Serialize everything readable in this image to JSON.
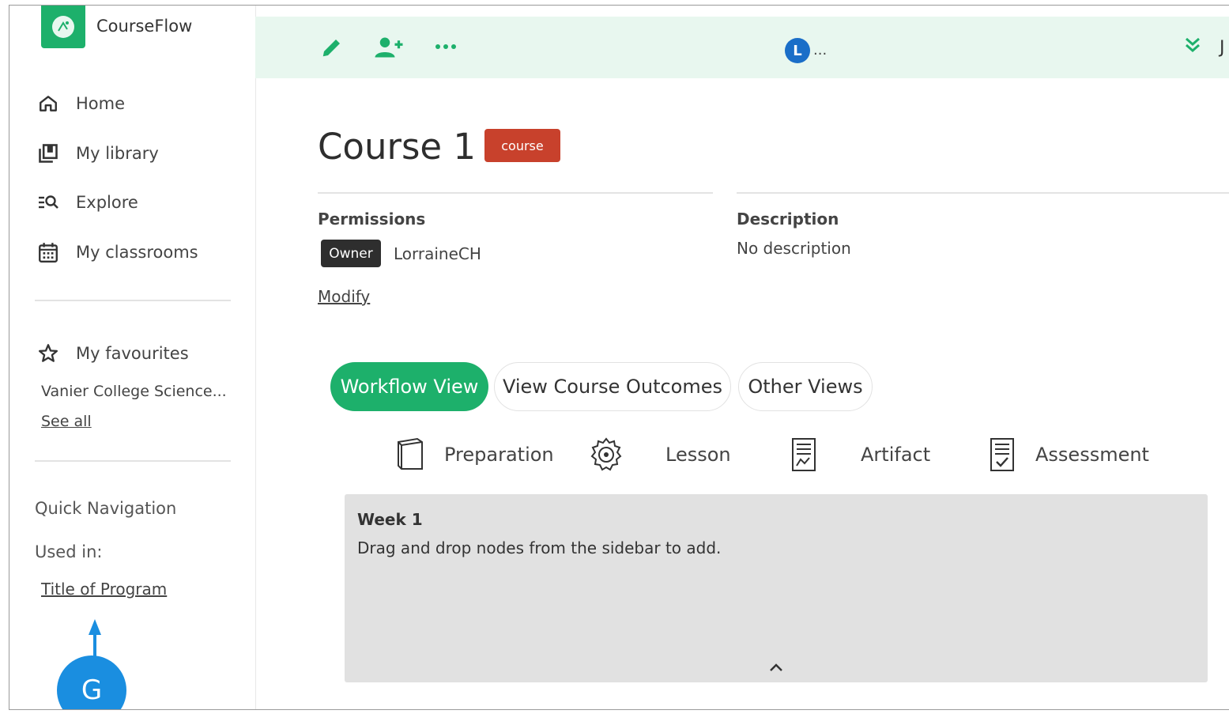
{
  "app": {
    "name": "CourseFlow"
  },
  "sidebar": {
    "nav": [
      {
        "label": "Home",
        "icon": "home-icon"
      },
      {
        "label": "My library",
        "icon": "library-icon"
      },
      {
        "label": "Explore",
        "icon": "explore-icon"
      },
      {
        "label": "My classrooms",
        "icon": "calendar-icon"
      }
    ],
    "favourites": {
      "label": "My favourites",
      "items": [
        "Vanier College Science..."
      ],
      "see_all": "See all"
    },
    "quick_nav": {
      "heading": "Quick Navigation",
      "used_in_label": "Used in:",
      "used_in_link": "Title of Program"
    }
  },
  "topbar": {
    "avatar_initial": "L",
    "avatar_more": "...",
    "right_text": "J"
  },
  "course": {
    "title": "Course 1",
    "type_badge": "course",
    "permissions": {
      "label": "Permissions",
      "role": "Owner",
      "user": "LorraineCH",
      "modify": "Modify"
    },
    "description": {
      "label": "Description",
      "value": "No description"
    }
  },
  "tabs": [
    {
      "label": "Workflow View",
      "active": true
    },
    {
      "label": "View Course Outcomes",
      "active": false
    },
    {
      "label": "Other Views",
      "active": false
    }
  ],
  "legend": [
    {
      "label": "Preparation",
      "icon": "preparation-icon"
    },
    {
      "label": "Lesson",
      "icon": "lesson-icon"
    },
    {
      "label": "Artifact",
      "icon": "artifact-icon"
    },
    {
      "label": "Assessment",
      "icon": "assessment-icon"
    }
  ],
  "week": {
    "title": "Week 1",
    "hint": "Drag and drop nodes from the sidebar to add."
  },
  "annotation": {
    "label": "G"
  },
  "colors": {
    "brand": "#1db06b",
    "topbar_bg": "#e8f7ef",
    "course_badge": "#c8412c",
    "annotation": "#1a8ee0"
  }
}
